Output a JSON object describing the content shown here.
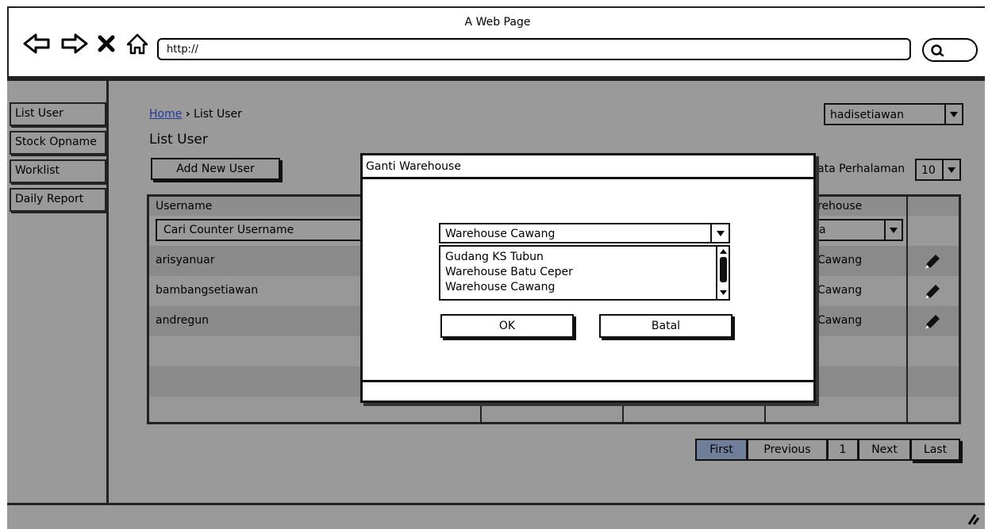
{
  "window": {
    "title": "A Web Page",
    "url": "http://"
  },
  "sidebar": {
    "items": [
      "List User",
      "Stock Opname",
      "Worklist",
      "Daily Report"
    ]
  },
  "breadcrumb": {
    "home": "Home",
    "current": "List User"
  },
  "page": {
    "title": "List User",
    "add_button": "Add New User"
  },
  "user_select": {
    "value": "hadisetiawan"
  },
  "page_size": {
    "label": "ata Perhalaman",
    "value": "10"
  },
  "table": {
    "header_left": "Username",
    "header_right": "rehouse",
    "filter_placeholder": "Cari Counter Username",
    "filter_right": "a",
    "rows": [
      {
        "username": "arisyanuar",
        "warehouse": "Cawang"
      },
      {
        "username": "bambangsetiawan",
        "warehouse": "Cawang"
      },
      {
        "username": "andregun",
        "warehouse": "Cawang"
      }
    ]
  },
  "pagination": {
    "first": "First",
    "previous": "Previous",
    "page": "1",
    "next": "Next",
    "last": "Last"
  },
  "dialog": {
    "title": "Ganti Warehouse",
    "selected": "Warehouse Cawang",
    "options": [
      "Gudang KS Tubun",
      "Warehouse Batu Ceper",
      "Warehouse Cawang"
    ],
    "ok": "OK",
    "cancel": "Batal"
  },
  "colors": {
    "overlay": "#9a9a9a",
    "active_page": "#6f7f99",
    "link": "#1f3a9b"
  }
}
